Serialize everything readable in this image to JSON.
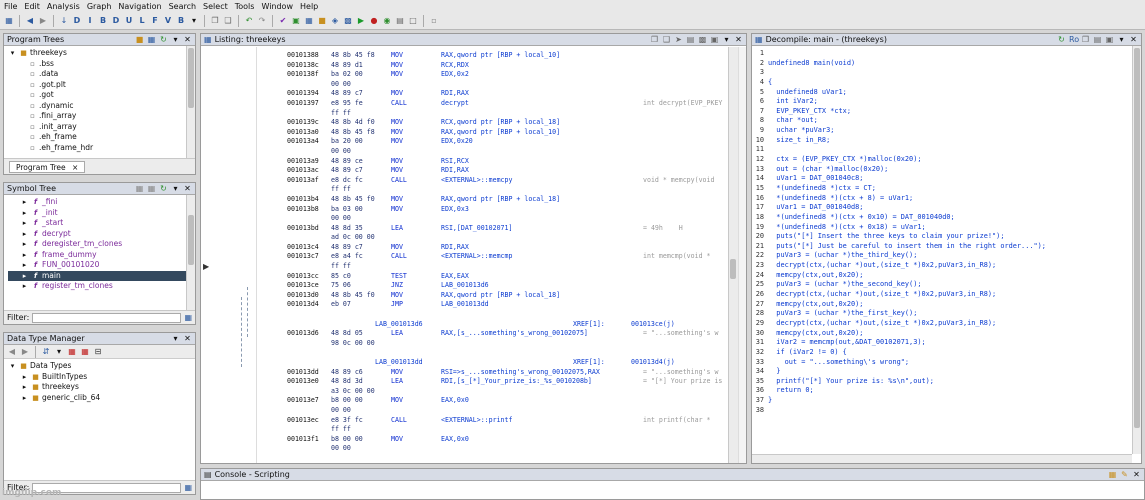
{
  "menu": [
    "File",
    "Edit",
    "Analysis",
    "Graph",
    "Navigation",
    "Search",
    "Select",
    "Tools",
    "Window",
    "Help"
  ],
  "toolbar_icons": [
    "save-icon",
    "back-icon",
    "forward-icon",
    "download-icon",
    "letter-d-icon",
    "letter-i-icon",
    "letter-b-icon",
    "letter-d2-icon",
    "letter-u-icon",
    "letter-l-icon",
    "letter-f-icon",
    "letter-v-icon",
    "letter-b2-icon",
    "dropdown-icon",
    "copy-icon",
    "paste-icon",
    "undo-icon",
    "redo-icon",
    "check-icon",
    "graph-icon",
    "table-icon",
    "folder-icon",
    "filter-icon",
    "memory-icon",
    "run-icon",
    "stop-icon",
    "record-icon",
    "listing-icon",
    "window-icon",
    "help-icon"
  ],
  "program_trees": {
    "title": "Program Trees",
    "root": "threekeys",
    "items": [
      ".bss",
      ".data",
      ".got.plt",
      ".got",
      ".dynamic",
      ".fini_array",
      ".init_array",
      ".eh_frame",
      ".eh_frame_hdr"
    ],
    "tab": "Program Tree",
    "close": "×"
  },
  "symbol_tree": {
    "title": "Symbol Tree",
    "items": [
      "_fini",
      "_init",
      "_start",
      "decrypt",
      "deregister_tm_clones",
      "frame_dummy",
      "FUN_00101020",
      "main",
      "register_tm_clones"
    ],
    "selected": "main",
    "filter_label": "Filter:"
  },
  "data_type_manager": {
    "title": "Data Type Manager",
    "root": "Data Types",
    "items": [
      "BuiltInTypes",
      "threekeys",
      "generic_clib_64"
    ],
    "filter_label": "Filter:"
  },
  "listing": {
    "title": "Listing:  threekeys",
    "rows": [
      {
        "addr": "00101388",
        "bytes": "48 8b 45 f8",
        "mn": "MOV",
        "op": "RAX,qword ptr [RBP + local_10]",
        "cmt": ""
      },
      {
        "addr": "0010138c",
        "bytes": "48 89 d1",
        "mn": "MOV",
        "op": "RCX,RDX",
        "cmt": ""
      },
      {
        "addr": "0010138f",
        "bytes": "ba 02 00",
        "mn": "MOV",
        "op": "EDX,0x2",
        "cmt": ""
      },
      {
        "addr": "",
        "bytes": "00 00",
        "mn": "",
        "op": "",
        "cmt": ""
      },
      {
        "addr": "00101394",
        "bytes": "48 89 c7",
        "mn": "MOV",
        "op": "RDI,RAX",
        "cmt": ""
      },
      {
        "addr": "00101397",
        "bytes": "e8 95 fe",
        "mn": "CALL",
        "op": "decrypt",
        "cmt": "int decrypt(EVP_PKEY"
      },
      {
        "addr": "",
        "bytes": "ff ff",
        "mn": "",
        "op": "",
        "cmt": ""
      },
      {
        "addr": "0010139c",
        "bytes": "48 8b 4d f0",
        "mn": "MOV",
        "op": "RCX,qword ptr [RBP + local_18]",
        "cmt": ""
      },
      {
        "addr": "001013a0",
        "bytes": "48 8b 45 f8",
        "mn": "MOV",
        "op": "RAX,qword ptr [RBP + local_10]",
        "cmt": ""
      },
      {
        "addr": "001013a4",
        "bytes": "ba 20 00",
        "mn": "MOV",
        "op": "EDX,0x20",
        "cmt": ""
      },
      {
        "addr": "",
        "bytes": "00 00",
        "mn": "",
        "op": "",
        "cmt": ""
      },
      {
        "addr": "001013a9",
        "bytes": "48 89 ce",
        "mn": "MOV",
        "op": "RSI,RCX",
        "cmt": ""
      },
      {
        "addr": "001013ac",
        "bytes": "48 89 c7",
        "mn": "MOV",
        "op": "RDI,RAX",
        "cmt": ""
      },
      {
        "addr": "001013af",
        "bytes": "e8 dc fc",
        "mn": "CALL",
        "op": "<EXTERNAL>::memcpy",
        "cmt": "void * memcpy(void"
      },
      {
        "addr": "",
        "bytes": "ff ff",
        "mn": "",
        "op": "",
        "cmt": ""
      },
      {
        "addr": "001013b4",
        "bytes": "48 8b 45 f0",
        "mn": "MOV",
        "op": "RAX,qword ptr [RBP + local_18]",
        "cmt": ""
      },
      {
        "addr": "001013b8",
        "bytes": "ba 03 00",
        "mn": "MOV",
        "op": "EDX,0x3",
        "cmt": ""
      },
      {
        "addr": "",
        "bytes": "00 00",
        "mn": "",
        "op": "",
        "cmt": ""
      },
      {
        "addr": "001013bd",
        "bytes": "48 8d 35",
        "mn": "LEA",
        "op": "RSI,[DAT_00102071]",
        "cmt": "= 49h    H"
      },
      {
        "addr": "",
        "bytes": "ad 0c 00 00",
        "mn": "",
        "op": "",
        "cmt": ""
      },
      {
        "addr": "001013c4",
        "bytes": "48 89 c7",
        "mn": "MOV",
        "op": "RDI,RAX",
        "cmt": ""
      },
      {
        "addr": "001013c7",
        "bytes": "e8 a4 fc",
        "mn": "CALL",
        "op": "<EXTERNAL>::memcmp",
        "cmt": "int memcmp(void *"
      },
      {
        "addr": "",
        "bytes": "ff ff",
        "mn": "",
        "op": "",
        "cmt": ""
      },
      {
        "addr": "001013cc",
        "bytes": "85 c0",
        "mn": "TEST",
        "op": "EAX,EAX",
        "cmt": ""
      },
      {
        "addr": "001013ce",
        "bytes": "75 06",
        "mn": "JNZ",
        "op": "LAB_001013d6",
        "cmt": ""
      },
      {
        "addr": "001013d0",
        "bytes": "48 8b 45 f0",
        "mn": "MOV",
        "op": "RAX,qword ptr [RBP + local_18]",
        "cmt": ""
      },
      {
        "addr": "001013d4",
        "bytes": "eb 07",
        "mn": "JMP",
        "op": "LAB_001013dd",
        "cmt": ""
      },
      {
        "addr": "",
        "bytes": "",
        "mn": "",
        "op": "",
        "cmt": ""
      },
      {
        "label": "LAB_001013d6",
        "xref": "XREF[1]:",
        "xaddr": "001013ce(j)"
      },
      {
        "addr": "001013d6",
        "bytes": "48 8d 05",
        "mn": "LEA",
        "op": "RAX,[s_...something's_wrong_00102075]",
        "cmt": "= \"...something's w"
      },
      {
        "addr": "",
        "bytes": "98 0c 00 00",
        "mn": "",
        "op": "",
        "cmt": ""
      },
      {
        "addr": "",
        "bytes": "",
        "mn": "",
        "op": "",
        "cmt": ""
      },
      {
        "label": "LAB_001013dd",
        "xref": "XREF[1]:",
        "xaddr": "001013d4(j)"
      },
      {
        "addr": "001013dd",
        "bytes": "48 89 c6",
        "mn": "MOV",
        "op": "RSI=>s_...something's_wrong_00102075,RAX",
        "cmt": "= \"...something's w"
      },
      {
        "addr": "001013e0",
        "bytes": "48 8d 3d",
        "mn": "LEA",
        "op": "RDI,[s_[*]_Your_prize_is:_%s_0010208b]",
        "cmt": "= \"[*] Your prize is"
      },
      {
        "addr": "",
        "bytes": "a3 0c 00 00",
        "mn": "",
        "op": "",
        "cmt": ""
      },
      {
        "addr": "001013e7",
        "bytes": "b8 00 00",
        "mn": "MOV",
        "op": "EAX,0x0",
        "cmt": ""
      },
      {
        "addr": "",
        "bytes": "00 00",
        "mn": "",
        "op": "",
        "cmt": ""
      },
      {
        "addr": "001013ec",
        "bytes": "e8 3f fc",
        "mn": "CALL",
        "op": "<EXTERNAL>::printf",
        "cmt": "int printf(char *"
      },
      {
        "addr": "",
        "bytes": "ff ff",
        "mn": "",
        "op": "",
        "cmt": ""
      },
      {
        "addr": "001013f1",
        "bytes": "b8 00 00",
        "mn": "MOV",
        "op": "EAX,0x0",
        "cmt": ""
      },
      {
        "addr": "",
        "bytes": "00 00",
        "mn": "",
        "op": "",
        "cmt": ""
      }
    ]
  },
  "decompile": {
    "title": "Decompile: main - (threekeys)",
    "lines": [
      "",
      "undefined8 main(void)",
      "",
      "{",
      "  undefined8 uVar1;",
      "  int iVar2;",
      "  EVP_PKEY_CTX *ctx;",
      "  char *out;",
      "  uchar *puVar3;",
      "  size_t in_R8;",
      "",
      "  ctx = (EVP_PKEY_CTX *)malloc(0x20);",
      "  out = (char *)malloc(0x20);",
      "  uVar1 = DAT_001040c8;",
      "  *(undefined8 *)ctx = CT;",
      "  *(undefined8 *)(ctx + 8) = uVar1;",
      "  uVar1 = DAT_001040d8;",
      "  *(undefined8 *)(ctx + 0x10) = DAT_001040d0;",
      "  *(undefined8 *)(ctx + 0x18) = uVar1;",
      "  puts(\"[*] Insert the three keys to claim your prize!\");",
      "  puts(\"[*] Just be careful to insert them in the right order...\");",
      "  puVar3 = (uchar *)the_third_key();",
      "  decrypt(ctx,(uchar *)out,(size_t *)0x2,puVar3,in_R8);",
      "  memcpy(ctx,out,0x20);",
      "  puVar3 = (uchar *)the_second_key();",
      "  decrypt(ctx,(uchar *)out,(size_t *)0x2,puVar3,in_R8);",
      "  memcpy(ctx,out,0x20);",
      "  puVar3 = (uchar *)the_first_key();",
      "  decrypt(ctx,(uchar *)out,(size_t *)0x2,puVar3,in_R8);",
      "  memcpy(ctx,out,0x20);",
      "  iVar2 = memcmp(out,&DAT_00102071,3);",
      "  if (iVar2 != 0) {",
      "    out = \"...something\\'s wrong\";",
      "  }",
      "  printf(\"[*] Your prize is: %s\\n\",out);",
      "  return 0;",
      "}",
      ""
    ]
  },
  "console": {
    "title": "Console - Scripting"
  },
  "watermark": "imgflip.com"
}
